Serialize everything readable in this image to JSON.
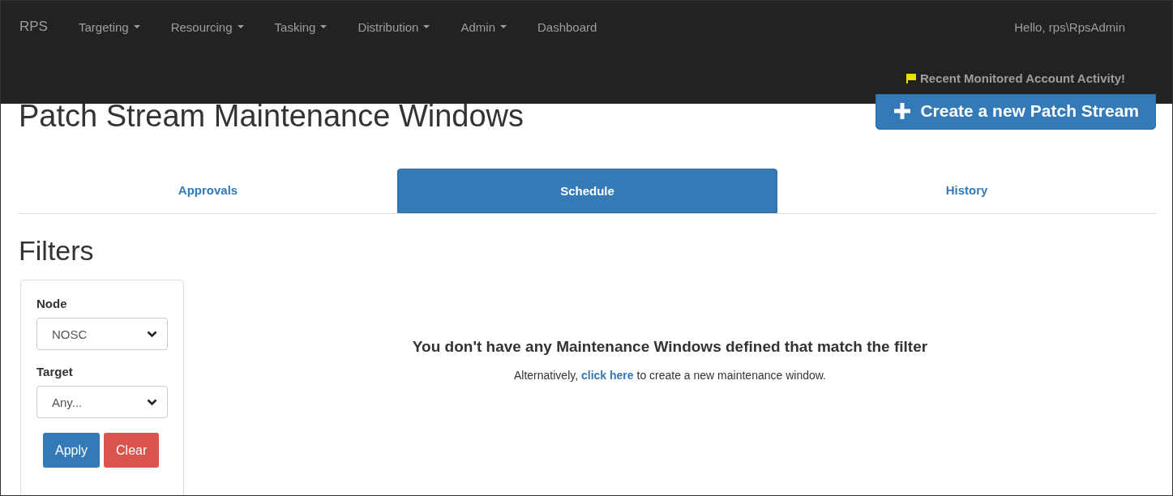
{
  "navbar": {
    "brand": "RPS",
    "menus": [
      {
        "label": "Targeting",
        "dropdown": true
      },
      {
        "label": "Resourcing",
        "dropdown": true
      },
      {
        "label": "Tasking",
        "dropdown": true
      },
      {
        "label": "Distribution",
        "dropdown": true
      },
      {
        "label": "Admin",
        "dropdown": true
      },
      {
        "label": "Dashboard",
        "dropdown": false
      }
    ],
    "greeting": "Hello, rps\\RpsAdmin",
    "alert": "Recent Monitored Account Activity!"
  },
  "page": {
    "title": "Patch Stream Maintenance Windows",
    "create_button": "Create a new Patch Stream"
  },
  "tabs": [
    {
      "label": "Approvals",
      "selected": false
    },
    {
      "label": "Schedule",
      "selected": true
    },
    {
      "label": "History",
      "selected": false
    }
  ],
  "filters": {
    "heading": "Filters",
    "fields": [
      {
        "label": "Node",
        "value": "NOSC"
      },
      {
        "label": "Target",
        "value": "Any..."
      }
    ],
    "apply": "Apply",
    "clear": "Clear"
  },
  "empty_state": {
    "message": "You don't have any Maintenance Windows defined that match the filter",
    "hint_before": "Alternatively,",
    "link": "click here",
    "hint_after": "to create a new maintenance window."
  }
}
